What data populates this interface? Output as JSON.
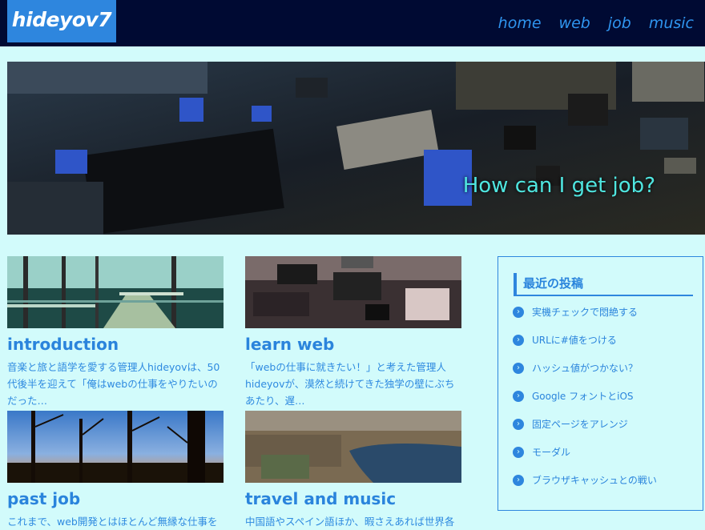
{
  "header": {
    "logo": "hideyov7",
    "nav": [
      "home",
      "web",
      "job",
      "music"
    ]
  },
  "hero": {
    "caption": "How can I get job?"
  },
  "cards": [
    {
      "title": "introduction",
      "excerpt": "音楽と旅と語学を愛する管理人hideyovは、50代後半を迎えて「俺はwebの仕事をやりたいのだった…",
      "image": "forest-boardwalk-photo"
    },
    {
      "title": "learn web",
      "excerpt": "「webの仕事に就きたい！」と考えた管理人hideyovが、漠然と続けてきた独学の壁にぶちあたり、遅…",
      "image": "circuit-board-photo"
    },
    {
      "title": "past job",
      "excerpt": "これまで、web開発とはほとんど無縁な仕事を",
      "image": "sunset-trees-photo"
    },
    {
      "title": "travel and music",
      "excerpt": "中国語やスペイン語ほか、暇さえあれば世界各",
      "image": "coastal-aerial-photo"
    }
  ],
  "sidebar": {
    "title": "最近の投稿",
    "items": [
      "実機チェックで悶絶する",
      "URLに#値をつける",
      "ハッシュ値がつかない？",
      "Google フォントとiOS",
      "固定ページをアレンジ",
      "モーダル",
      "ブラウザキャッシュとの戦い"
    ]
  },
  "colors": {
    "background": "#d2fbfb",
    "header": "#000a33",
    "accent": "#2e86de",
    "hero_text": "#4fe6e0"
  }
}
